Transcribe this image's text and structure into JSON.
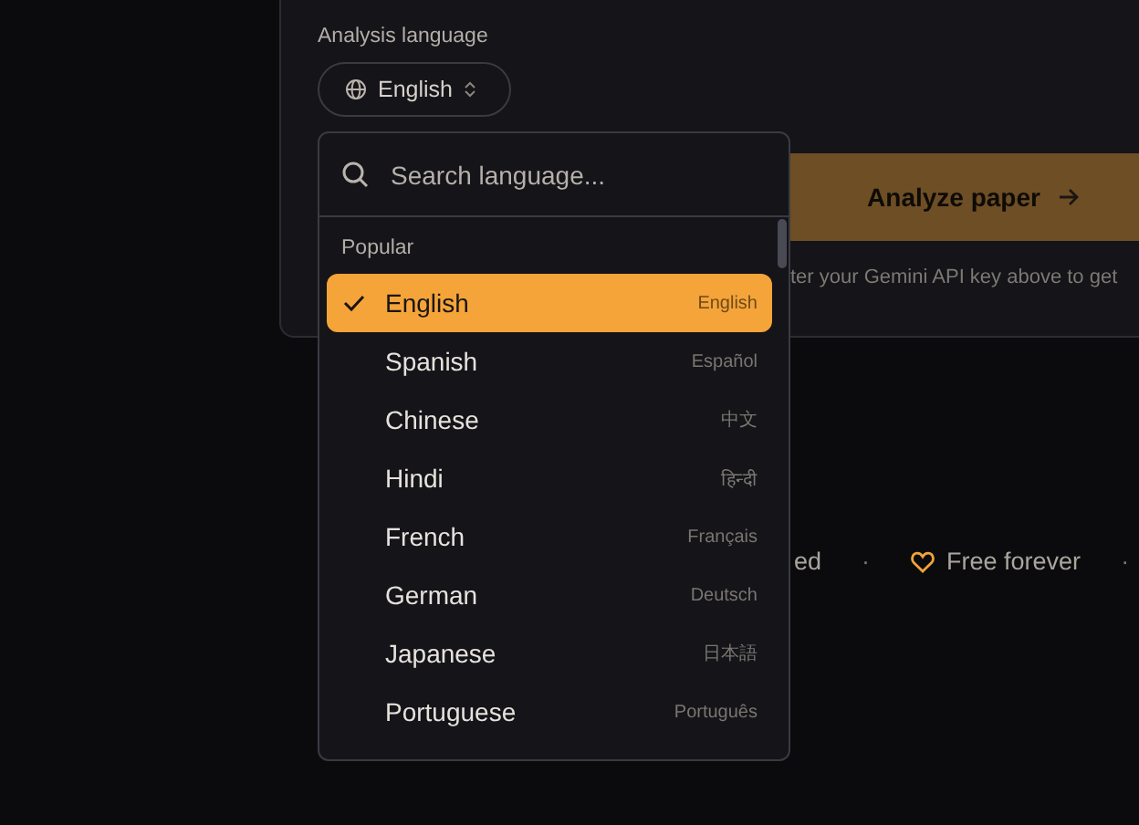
{
  "form": {
    "label": "Analysis language",
    "language_button": "English",
    "analyze_button": "Analyze paper",
    "hint": "ter your Gemini API key above to get"
  },
  "dropdown": {
    "search": {
      "placeholder": "Search language..."
    },
    "group": "Popular",
    "items": [
      {
        "name": "English",
        "native": "English",
        "selected": true
      },
      {
        "name": "Spanish",
        "native": "Español",
        "selected": false
      },
      {
        "name": "Chinese",
        "native": "中文",
        "selected": false
      },
      {
        "name": "Hindi",
        "native": "हिन्दी",
        "selected": false
      },
      {
        "name": "French",
        "native": "Français",
        "selected": false
      },
      {
        "name": "German",
        "native": "Deutsch",
        "selected": false
      },
      {
        "name": "Japanese",
        "native": "日本語",
        "selected": false
      },
      {
        "name": "Portuguese",
        "native": "Português",
        "selected": false
      }
    ]
  },
  "features": [
    {
      "kind": "text",
      "label": "ed"
    },
    {
      "kind": "dot",
      "label": "·"
    },
    {
      "kind": "heart",
      "label": "Free forever"
    },
    {
      "kind": "dot",
      "label": "·"
    }
  ]
}
